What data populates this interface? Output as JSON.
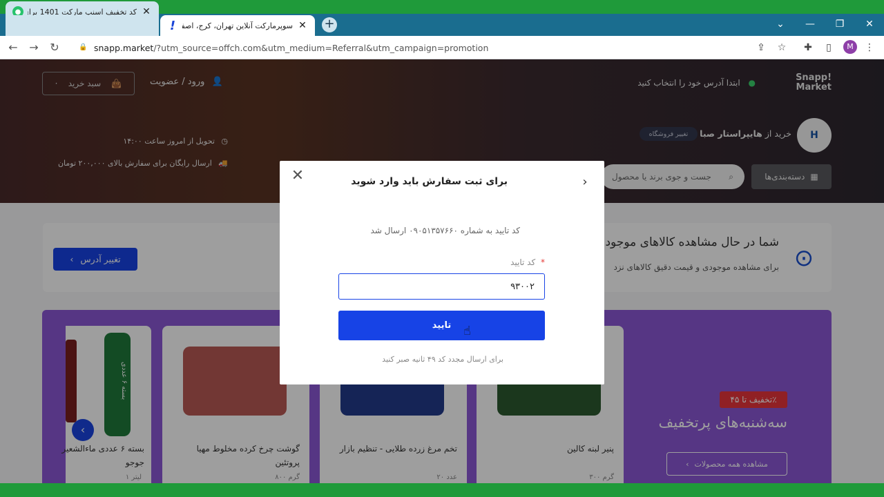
{
  "browser": {
    "tabs": [
      {
        "title": "کد تخفیف اسنپ مارکت 1401 برای",
        "active": false,
        "favicon": "snappmarket-favicon"
      },
      {
        "title": "سوپرمارکت آنلاین تهران، کرج، اصفه",
        "active": true,
        "favicon": "exclamation-favicon"
      }
    ],
    "new_tab": "+",
    "window_controls": {
      "dropdown": "⌄",
      "minimize": "—",
      "restore": "❐",
      "close": "✕"
    },
    "url_host": "snapp.market",
    "url_path": "/?utm_source=offch.com&utm_medium=Referral&utm_campaign=promotion",
    "profile_initial": "M"
  },
  "header": {
    "logo_line1": "Snapp!",
    "logo_line2": "Market",
    "address_prompt": "ابتدا آدرس خود را انتخاب کنید",
    "login": "ورود / عضویت",
    "cart": "سبد خرید",
    "store_prefix": "خرید از",
    "store_name": "هایپراستار صبا",
    "change_store": "تغییر فروشگاه",
    "delivery": "تحویل از امروز ساعت ۱۴:۰۰",
    "free_shipping": "ارسال رایگان برای سفارش بالای ۲۰۰,۰۰۰ تومان",
    "categories": "دسته‌بندی‌ها",
    "search_placeholder": "جست و جوی برند یا محصول"
  },
  "address_card": {
    "title": "شما در حال مشاهده کالاهای موجود د",
    "subtitle": "برای مشاهده موجودی و قیمت دقیق کالاهای نزد",
    "change_button": "تغییر آدرس"
  },
  "promo": {
    "discount_tag": "تخفیف تا ۴۵٪",
    "title": "سه‌شنبه‌های پرتخفیف",
    "view_all": "مشاهده همه محصولات",
    "products": [
      {
        "name": "پنیر لبنه کالین",
        "weight": "۳۰۰ گرم"
      },
      {
        "name": "تخم مرغ زرده طلایی - تنظیم بازار",
        "weight": "۲۰ عدد"
      },
      {
        "name": "گوشت چرخ کرده مخلوط مهیا پروتئین",
        "weight": "۸۰۰ گرم"
      },
      {
        "name": "بسته ۶ عددی ماءالشعیر جوجو",
        "weight": "۱ لیتر"
      }
    ],
    "pack_label": "بسته ۶ عددی"
  },
  "modal": {
    "title": "برای ثبت سفارش باید وارد شوید",
    "info": "کد تایید به شماره ۰۹۰۵۱۳۵۷۶۶۰ ارسال شد",
    "field_label": "کد تایید",
    "required_mark": "*",
    "code_value": "۹۳۰۰۲",
    "confirm": "تایید",
    "resend": "برای ارسال مجدد کد ۴۹ ثانیه صبر کنید"
  }
}
